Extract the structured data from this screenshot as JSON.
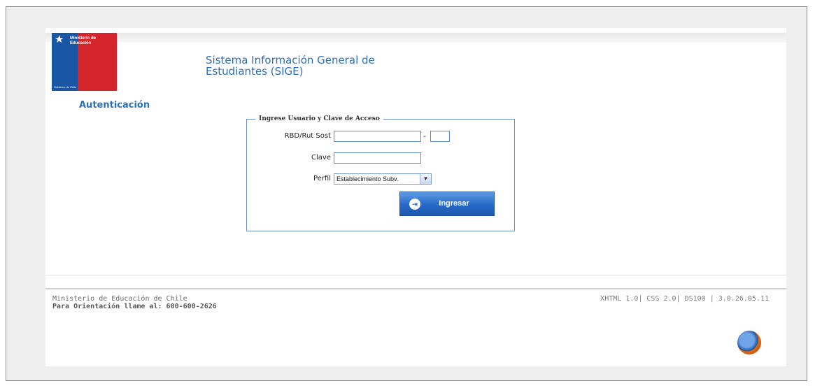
{
  "header": {
    "logo": {
      "text": "Ministerio de\nEducación",
      "footer": "Gobierno de Chile"
    },
    "system_title": "Sistema Información General de\nEstudiantes (SIGE)"
  },
  "section": {
    "title": "Autenticación"
  },
  "login_form": {
    "legend": "Ingrese Usuario y Clave de Acceso",
    "rbd_label": "RBD/Rut Sost",
    "rbd_value": "",
    "dv_value": "",
    "separator": "-",
    "password_label": "Clave",
    "password_value": "",
    "profile_label": "Perfil",
    "profile_selected": "Establecimiento Subv.",
    "submit_label": "Ingresar"
  },
  "footer": {
    "org": "Ministerio de Educación de Chile",
    "phone": "Para Orientación llame al: 600-600-2626",
    "version": "XHTML 1.0| CSS 2.0| DS100 | 3.0.26.05.11"
  },
  "icons": {
    "logo": "chilean-government-logo",
    "firefox": "firefox-icon",
    "login": "login-icon",
    "select": "chevron-down-icon"
  },
  "colors": {
    "title_blue": "#2f6fb8",
    "button_blue": "#2669c8",
    "logo_red": "#d4242c",
    "logo_blue": "#1a56a6"
  }
}
